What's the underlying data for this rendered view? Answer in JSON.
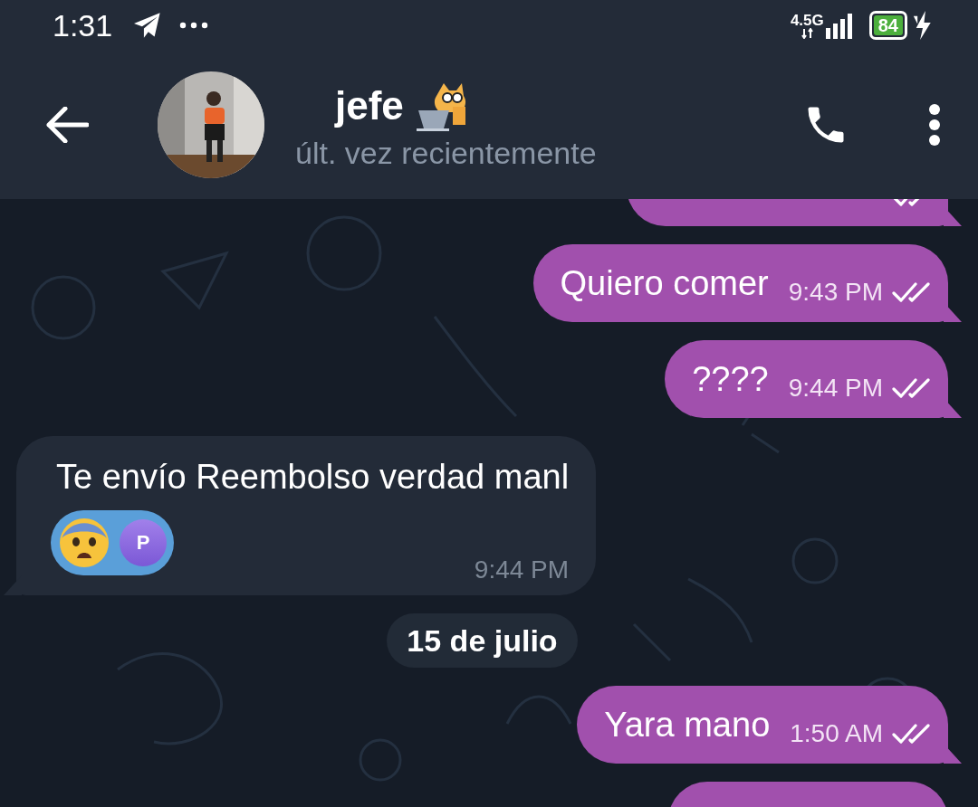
{
  "status_bar": {
    "time": "1:31",
    "network": "4.5G",
    "battery": "84"
  },
  "header": {
    "name": "jefe",
    "status": "últ. vez recientemente"
  },
  "messages": [
    {
      "kind": "outgoing",
      "read": true,
      "cut_at_top": true
    },
    {
      "kind": "outgoing",
      "text": "Quiero comer",
      "time": "9:43 PM",
      "read": true
    },
    {
      "kind": "outgoing",
      "text": "????",
      "time": "9:44 PM",
      "read": true
    },
    {
      "kind": "incoming",
      "text": "Te envío Reembolso verdad manl",
      "time": "9:44 PM",
      "reaction": {
        "user_initial": "P"
      }
    },
    {
      "kind": "date",
      "text": "15 de julio"
    },
    {
      "kind": "outgoing",
      "text": "Yara mano",
      "time": "1:50 AM",
      "read": true
    },
    {
      "kind": "outgoing"
    }
  ]
}
